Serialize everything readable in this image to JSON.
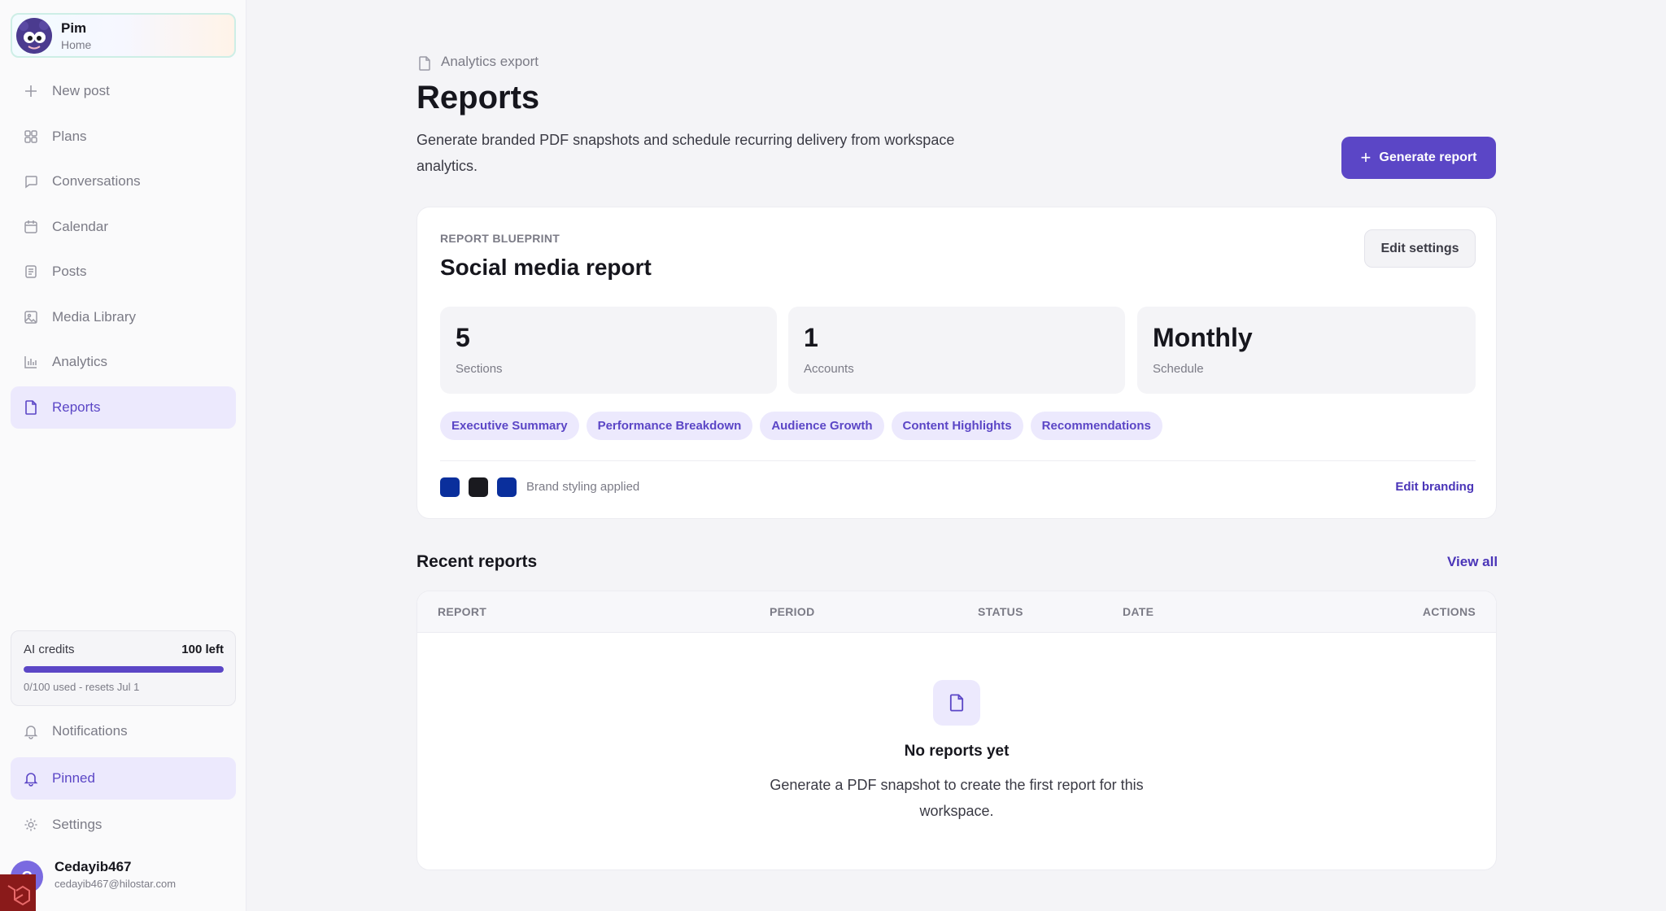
{
  "sidebar": {
    "profile": {
      "name": "Pim",
      "sub": "Home"
    },
    "nav": [
      {
        "label": "New post",
        "icon": "plus-icon"
      },
      {
        "label": "Plans",
        "icon": "grid-icon"
      },
      {
        "label": "Conversations",
        "icon": "chat-bubble-icon"
      },
      {
        "label": "Calendar",
        "icon": "calendar-icon"
      },
      {
        "label": "Posts",
        "icon": "document-lines-icon"
      },
      {
        "label": "Media Library",
        "icon": "image-icon"
      },
      {
        "label": "Analytics",
        "icon": "bar-chart-icon"
      },
      {
        "label": "Reports",
        "icon": "file-icon",
        "active": true
      }
    ],
    "credits": {
      "title": "AI credits",
      "left": "100 left",
      "meta": "0/100 used - resets Jul 1",
      "used_fraction": 1.0
    },
    "bottom_nav": [
      {
        "label": "Notifications",
        "icon": "bell-icon"
      },
      {
        "label": "Pinned",
        "icon": "bell-icon",
        "active": true
      },
      {
        "label": "Settings",
        "icon": "gear-icon"
      }
    ],
    "user": {
      "name": "Cedayib467",
      "email": "cedayib467@hilostar.com",
      "initial": "C"
    }
  },
  "header": {
    "breadcrumb": "Analytics export",
    "title": "Reports",
    "description": "Generate branded PDF snapshots and schedule recurring delivery from workspace analytics.",
    "generate_label": "Generate report"
  },
  "blueprint": {
    "eyebrow": "REPORT BLUEPRINT",
    "title": "Social media report",
    "edit_settings_label": "Edit settings",
    "stats": [
      {
        "value": "5",
        "label": "Sections"
      },
      {
        "value": "1",
        "label": "Accounts"
      },
      {
        "value": "Monthly",
        "label": "Schedule"
      }
    ],
    "sections": [
      "Executive Summary",
      "Performance Breakdown",
      "Audience Growth",
      "Content Highlights",
      "Recommendations"
    ],
    "brand_colors": [
      "#0a2f9c",
      "#1a1a1f",
      "#0a2f9c"
    ],
    "brand_text": "Brand styling applied",
    "edit_branding_label": "Edit branding"
  },
  "recent": {
    "title": "Recent reports",
    "view_all_label": "View all",
    "columns": [
      "REPORT",
      "PERIOD",
      "STATUS",
      "DATE",
      "ACTIONS"
    ],
    "empty_title": "No reports yet",
    "empty_desc": "Generate a PDF snapshot to create the first report for this workspace."
  },
  "colors": {
    "accent": "#5b46c6",
    "accent_soft": "#ece9fd"
  }
}
